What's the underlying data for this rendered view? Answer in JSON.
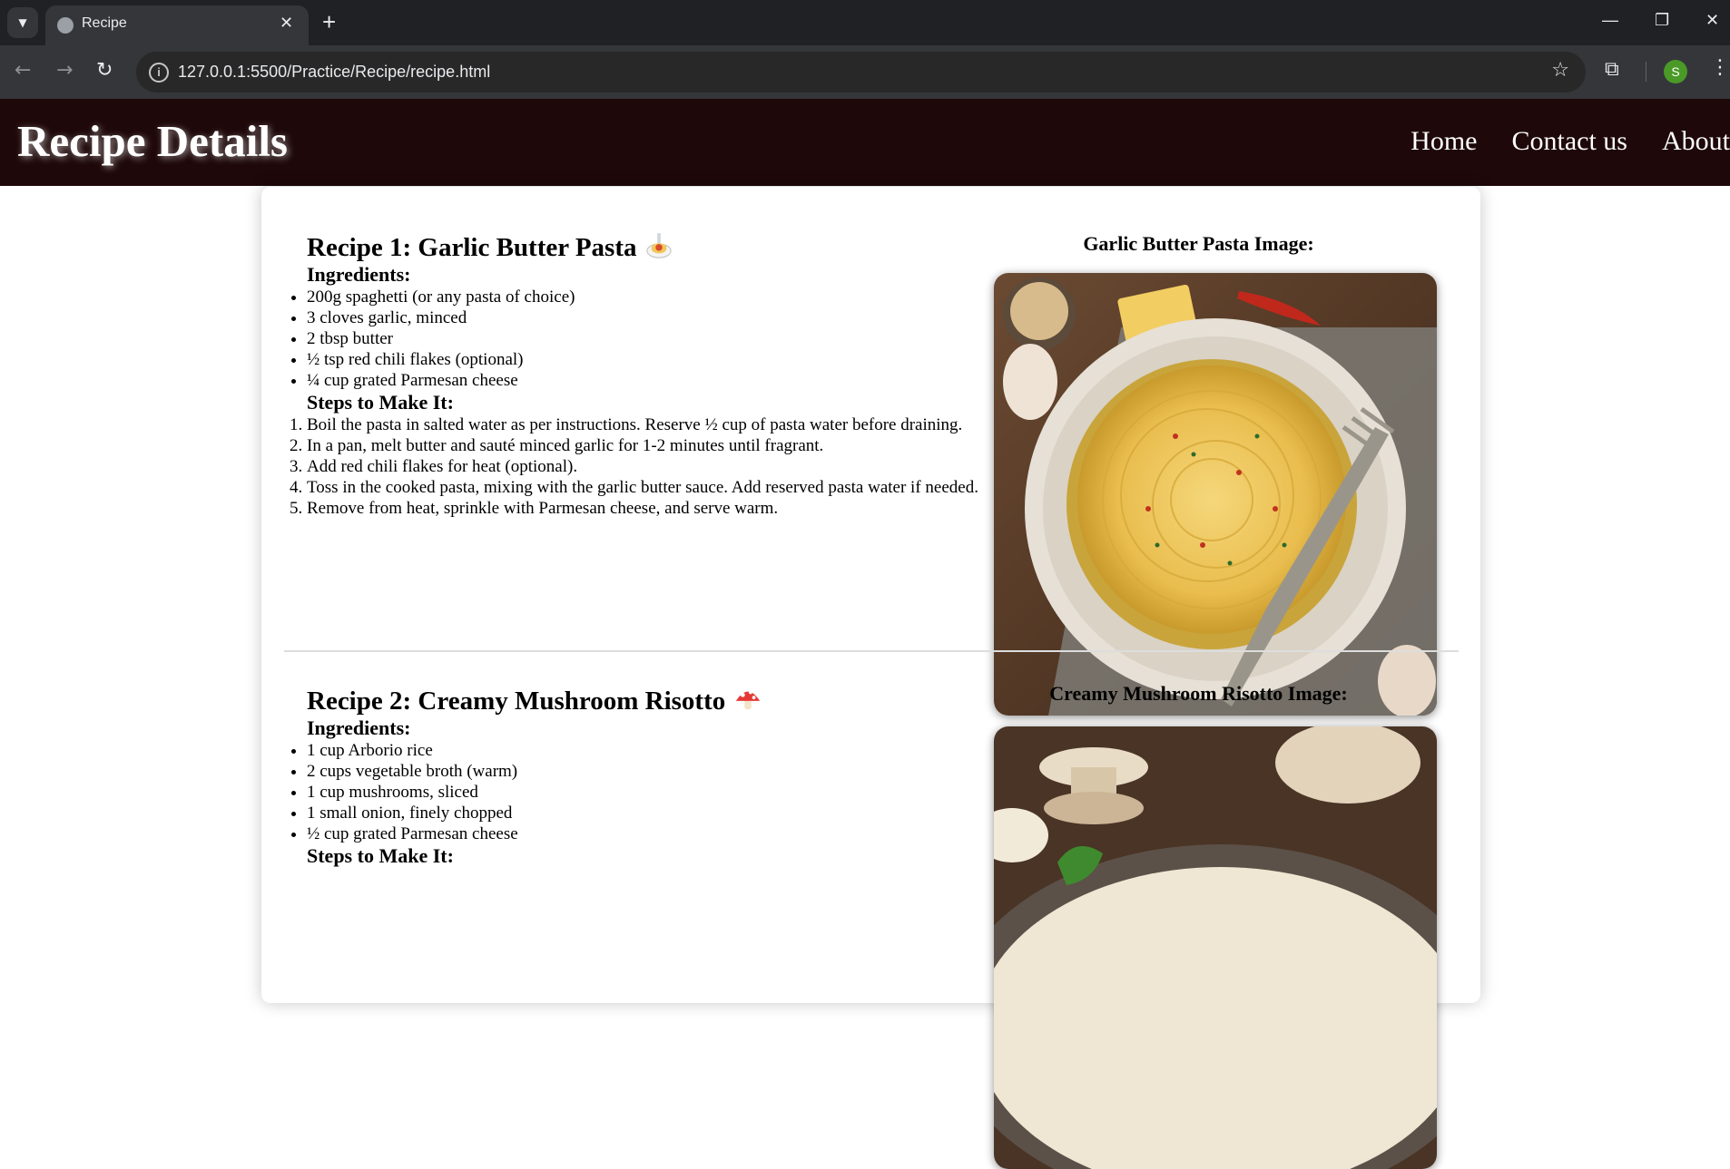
{
  "browser": {
    "tab_title": "Recipe",
    "url": "127.0.0.1:5500/Practice/Recipe/recipe.html",
    "profile_initial": "S"
  },
  "header": {
    "title": "Recipe Details",
    "nav": [
      "Home",
      "Contact us",
      "About"
    ]
  },
  "recipes": [
    {
      "title": "Recipe 1: Garlic Butter Pasta",
      "emoji": "pasta",
      "ingredients_heading": "Ingredients:",
      "ingredients": [
        "200g spaghetti (or any pasta of choice)",
        "3 cloves garlic, minced",
        "2 tbsp butter",
        "½ tsp red chili flakes (optional)",
        "¼ cup grated Parmesan cheese"
      ],
      "steps_heading": "Steps to Make It:",
      "steps": [
        "Boil the pasta in salted water as per instructions. Reserve ½ cup of pasta water before draining.",
        "In a pan, melt butter and sauté minced garlic for 1-2 minutes until fragrant.",
        "Add red chili flakes for heat (optional).",
        "Toss in the cooked pasta, mixing with the garlic butter sauce. Add reserved pasta water if needed.",
        "Remove from heat, sprinkle with Parmesan cheese, and serve warm."
      ],
      "image_caption": "Garlic Butter Pasta Image:"
    },
    {
      "title": "Recipe 2: Creamy Mushroom Risotto",
      "emoji": "mushroom",
      "ingredients_heading": "Ingredients:",
      "ingredients": [
        "1 cup Arborio rice",
        "2 cups vegetable broth (warm)",
        "1 cup mushrooms, sliced",
        "1 small onion, finely chopped",
        "½ cup grated Parmesan cheese"
      ],
      "steps_heading": "Steps to Make It:",
      "image_caption": "Creamy Mushroom Risotto Image:"
    }
  ]
}
